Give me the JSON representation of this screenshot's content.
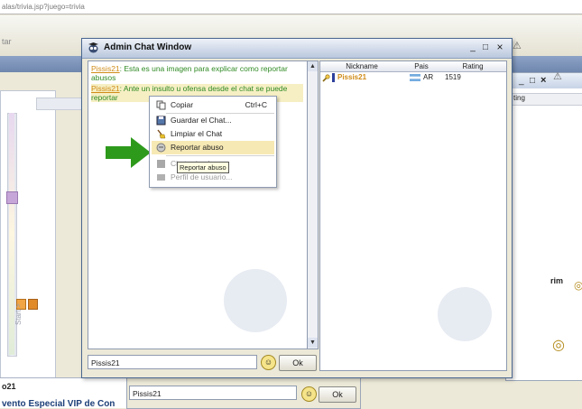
{
  "browser": {
    "url": "alas/trivia.jsp?juego=trivia",
    "toolbar_text": "tar"
  },
  "background": {
    "left_label": "Start >",
    "bottom_left_title": "o21",
    "bottom_left_banner": "vento Especial VIP de Con",
    "right_col_header": "ting",
    "right_partial_text": "rim",
    "bottom_chat_input": "Pissis21",
    "bottom_chat_ok": "Ok"
  },
  "window": {
    "title": "Admin Chat Window",
    "minimize": "_",
    "maximize": "□",
    "close": "×"
  },
  "chat": {
    "messages": [
      {
        "nick": "Pissis21",
        "text": ": Esta es una imagen para explicar como reportar abusos",
        "highlight": false
      },
      {
        "nick": "Pissis21",
        "text": ": Ante un insulto u ofensa desde el chat se puede reportar",
        "highlight": true
      }
    ],
    "input_value": "Pissis21",
    "ok_label": "Ok"
  },
  "users": {
    "columns": [
      "Nickname",
      "Pais",
      "Rating"
    ],
    "rows": [
      {
        "nickname": "Pissis21",
        "country": "AR",
        "rating": "1519"
      }
    ]
  },
  "context_menu": {
    "items": [
      {
        "label": "Copiar",
        "shortcut": "Ctrl+C",
        "icon": "copy-icon",
        "state": "normal"
      },
      {
        "label": "Guardar el Chat...",
        "shortcut": "",
        "icon": "save-icon",
        "state": "normal"
      },
      {
        "label": "Limpiar el Chat",
        "shortcut": "",
        "icon": "broom-icon",
        "state": "normal"
      },
      {
        "label": "Reportar abuso",
        "shortcut": "",
        "icon": "report-icon",
        "state": "selected"
      },
      {
        "label": "Chat privado",
        "shortcut": "",
        "icon": "private-chat-icon",
        "state": "disabled"
      },
      {
        "label": "Perfil de usuario...",
        "shortcut": "",
        "icon": "profile-icon",
        "state": "disabled"
      }
    ]
  },
  "tooltip": "Reportar abuso",
  "colors": {
    "accent_arrow": "#2e9a1c",
    "nick": "#d08b17",
    "message": "#2f8a24",
    "menu_selected": "#f7e9b4"
  }
}
